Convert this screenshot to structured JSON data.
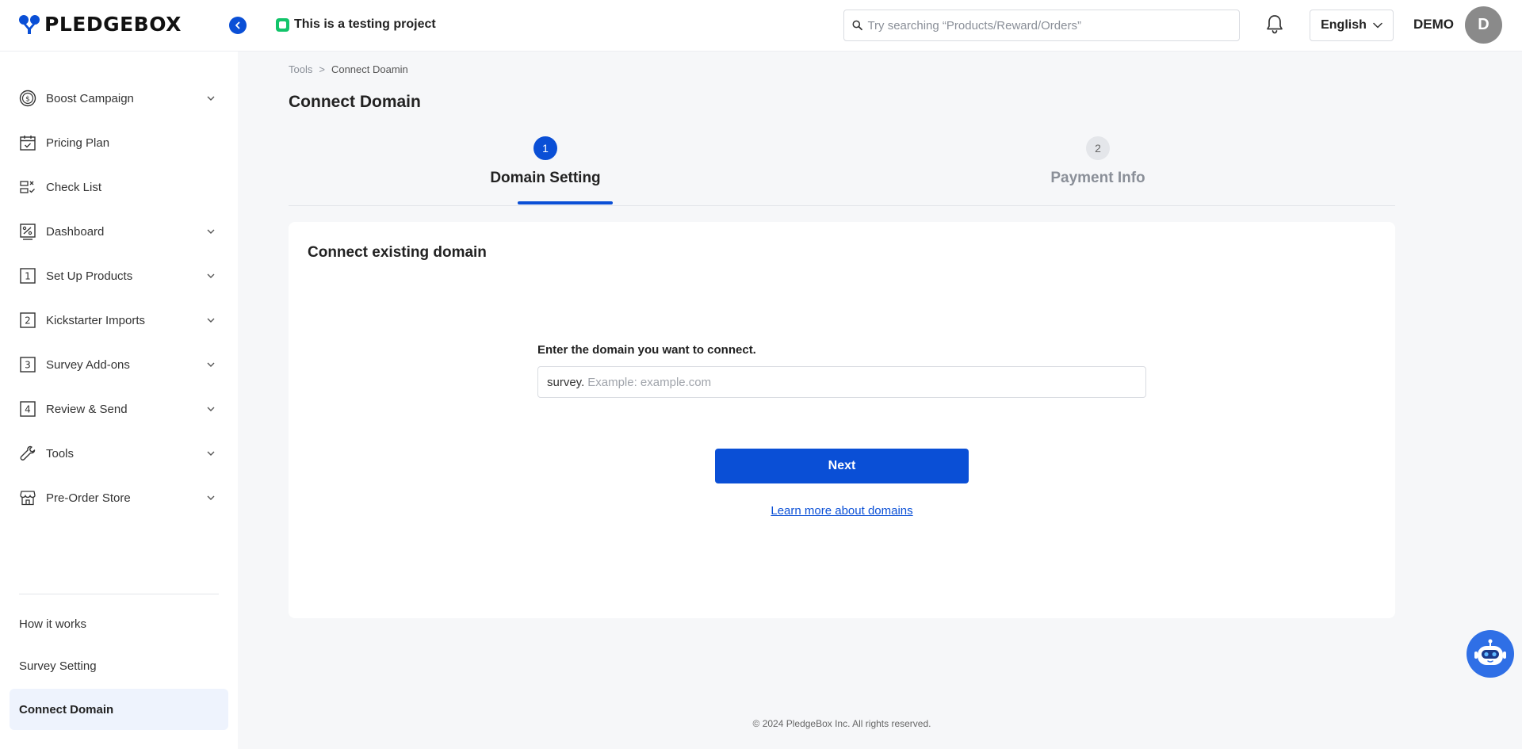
{
  "brand": {
    "name": "PLEDGEBOX",
    "accent": "#0a4fd6"
  },
  "header": {
    "project_badge": "This is a testing project",
    "search_placeholder": "Try searching “Products/Reward/Orders”",
    "language": "English",
    "user_name": "DEMO",
    "avatar_initial": "D"
  },
  "sidebar": {
    "items": [
      {
        "label": "Boost Campaign",
        "icon": "dollar-circle-icon",
        "expandable": true
      },
      {
        "label": "Pricing Plan",
        "icon": "calendar-check-icon",
        "expandable": false
      },
      {
        "label": "Check List",
        "icon": "checklist-icon",
        "expandable": false
      },
      {
        "label": "Dashboard",
        "icon": "percent-chart-icon",
        "expandable": true
      },
      {
        "label": "Set Up Products",
        "icon": "step-1-icon",
        "expandable": true
      },
      {
        "label": "Kickstarter Imports",
        "icon": "step-2-icon",
        "expandable": true
      },
      {
        "label": "Survey Add-ons",
        "icon": "step-3-icon",
        "expandable": true
      },
      {
        "label": "Review & Send",
        "icon": "step-4-icon",
        "expandable": true
      },
      {
        "label": "Tools",
        "icon": "wrench-icon",
        "expandable": true
      },
      {
        "label": "Pre-Order Store",
        "icon": "store-icon",
        "expandable": true
      }
    ],
    "bottom": {
      "how_it_works": "How it works",
      "survey_setting": "Survey Setting",
      "connect_domain": "Connect Domain"
    }
  },
  "breadcrumb": {
    "parent": "Tools",
    "separator": ">",
    "current": "Connect Doamin"
  },
  "page_title": "Connect Domain",
  "stepper": {
    "steps": [
      {
        "number": "1",
        "label": "Domain Setting",
        "active": true
      },
      {
        "number": "2",
        "label": "Payment Info",
        "active": false
      }
    ]
  },
  "card": {
    "title": "Connect existing domain",
    "field_label": "Enter the domain you want to connect.",
    "prefix": "survey.",
    "placeholder": "Example: example.com",
    "value": "",
    "next_label": "Next",
    "learn_more": "Learn more about domains"
  },
  "footer": "© 2024 PledgeBox Inc. All rights reserved."
}
